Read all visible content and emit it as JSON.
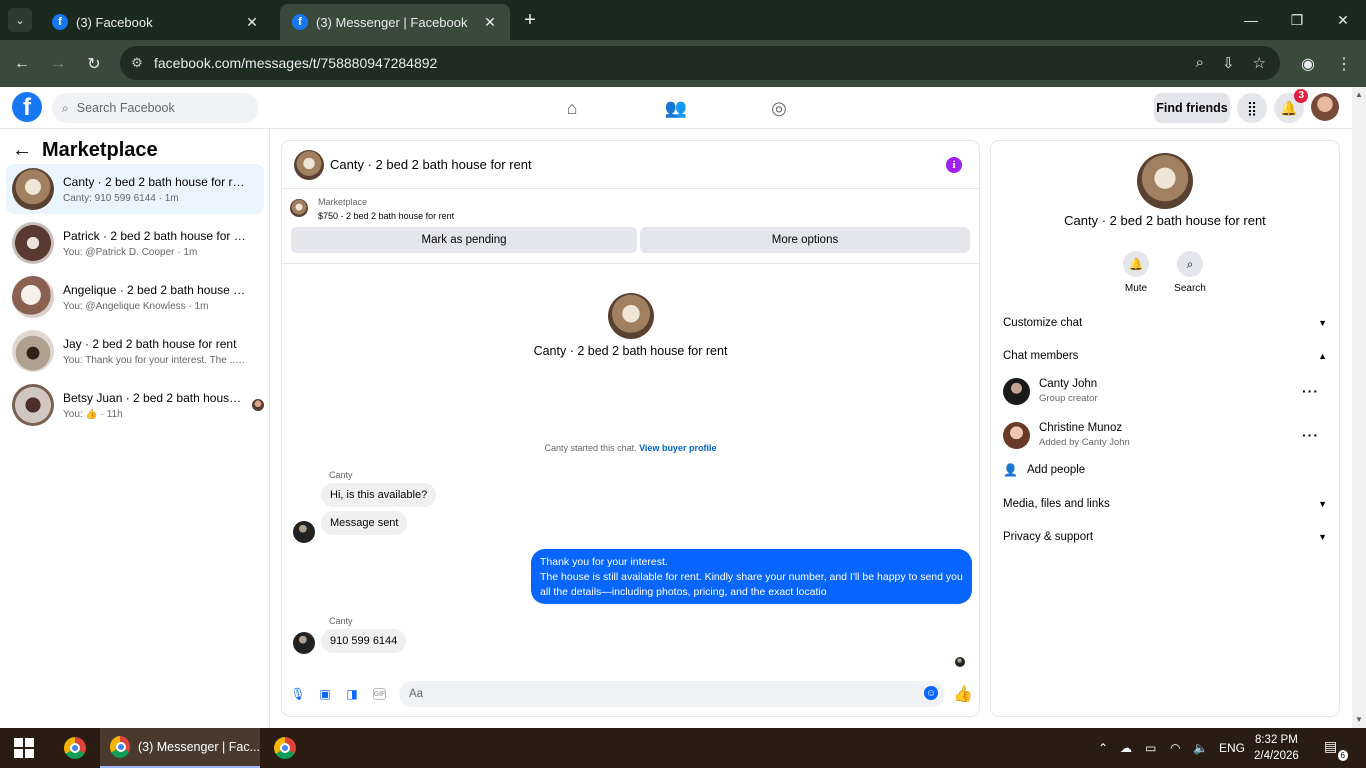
{
  "browser": {
    "tabs": [
      {
        "title": "(3) Facebook",
        "favicon": "f"
      },
      {
        "title": "(3) Messenger | Facebook",
        "favicon": "f"
      }
    ],
    "url": "facebook.com/messages/t/758880947284892"
  },
  "fb_header": {
    "logo": "f",
    "search_placeholder": "Search Facebook",
    "find_friends": "Find friends",
    "notification_count": "3"
  },
  "sidebar": {
    "title": "Marketplace",
    "conversations": [
      {
        "title": "Canty · 2 bed 2 bath house for rent",
        "subtitle": "Canty: 910 599 6144 · 1m"
      },
      {
        "title": "Patrick · 2 bed 2 bath house for rent",
        "subtitle": "You: @Patrick D. Cooper · 1m"
      },
      {
        "title": "Angelique · 2 bed 2 bath house fo...",
        "subtitle": "You: @Angelique Knowless · 1m"
      },
      {
        "title": "Jay · 2 bed 2 bath house for rent",
        "subtitle": "You: Thank you for your interest. The ...  1m"
      },
      {
        "title": "Betsy Juan · 2 bed 2 bath house ...",
        "subtitle": "You: 👍 · 11h"
      }
    ]
  },
  "chat": {
    "header_title": "Canty · 2 bed 2 bath house for rent",
    "marketplace_label": "Marketplace",
    "listing": "$750 - 2 bed 2 bath house for rent",
    "mark_pending": "Mark as pending",
    "more_options": "More options",
    "intro_title": "Canty · 2 bed 2 bath house for rent",
    "started_text": "Canty started this chat.",
    "buyer_profile_link": "View buyer profile",
    "sender_1": "Canty",
    "msg_1": "Hi, is this available?",
    "msg_2": "Message sent",
    "outgoing_line_1": "Thank you for your interest.",
    "outgoing_line_2": "The house is still available for rent. Kindly share your number, and I'll be happy to send you all the details—including photos, pricing, and the exact locatio",
    "sender_2": "Canty",
    "msg_3": "910 599 6144",
    "composer_placeholder": "Aa"
  },
  "details": {
    "title": "Canty · 2 bed 2 bath house for rent",
    "mute": "Mute",
    "search": "Search",
    "customize_chat": "Customize chat",
    "chat_members": "Chat members",
    "members": [
      {
        "name": "Canty John",
        "role": "Group creator"
      },
      {
        "name": "Christine Munoz",
        "role": "Added by Canty John"
      }
    ],
    "add_people": "Add people",
    "media": "Media, files and links",
    "privacy": "Privacy & support"
  },
  "taskbar": {
    "active_app": "(3) Messenger | Fac...",
    "language": "ENG",
    "time": "8:32 PM",
    "date": "2/4/2026",
    "notifications": "6"
  }
}
